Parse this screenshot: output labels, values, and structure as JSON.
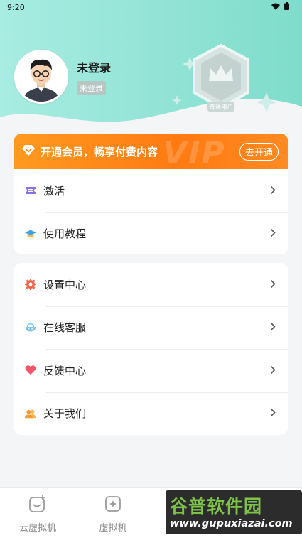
{
  "status_bar": {
    "time": "9:20"
  },
  "profile": {
    "name": "未登录",
    "badge": "未登录",
    "member_badge_label": "普通用户"
  },
  "vip": {
    "watermark": "VIP",
    "text": "开通会员，畅享付费内容",
    "button": "去开通"
  },
  "menu_group_1": [
    {
      "label": "激活",
      "icon": "ticket-icon"
    },
    {
      "label": "使用教程",
      "icon": "graduation-cap-icon"
    }
  ],
  "menu_group_2": [
    {
      "label": "设置中心",
      "icon": "gear-icon"
    },
    {
      "label": "在线客服",
      "icon": "customer-service-icon"
    },
    {
      "label": "反馈中心",
      "icon": "heart-icon"
    },
    {
      "label": "关于我们",
      "icon": "users-icon"
    }
  ],
  "tabbar": [
    {
      "label": "云虚拟机",
      "icon": "cloud-vm-icon"
    },
    {
      "label": "虚拟机",
      "icon": "vm-icon"
    },
    {
      "label": "",
      "icon": "tab3-icon"
    },
    {
      "label": "",
      "icon": "tab4-icon"
    }
  ],
  "overlay_watermark": {
    "title": "谷普软件园",
    "url": "www.gupuxiazai.com"
  },
  "colors": {
    "teal_header": "#8fe0d6",
    "vip_orange": "#ff8a1a",
    "background": "#f4f5f7"
  }
}
